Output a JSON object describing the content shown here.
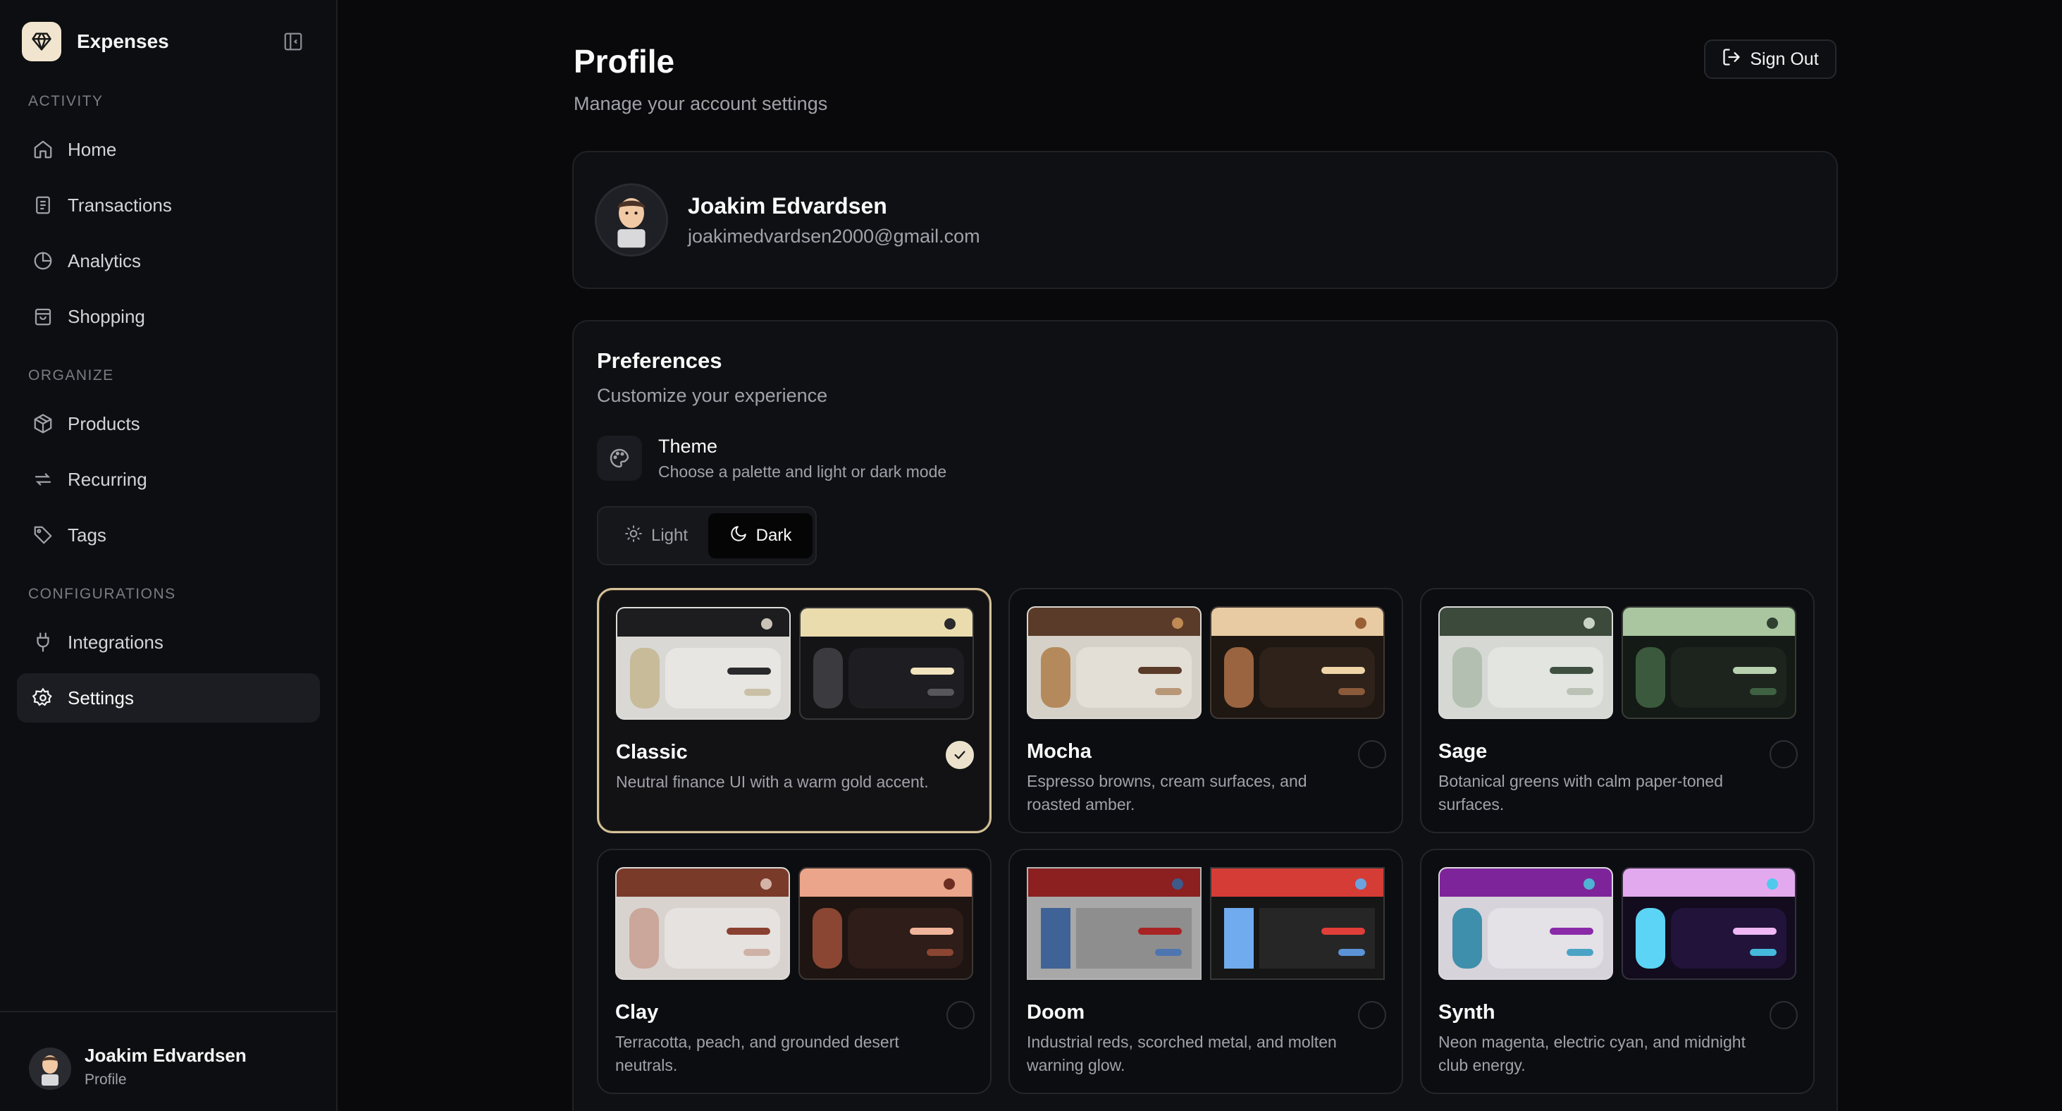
{
  "sidebar": {
    "brand": "Expenses",
    "sections": {
      "activity": "ACTIVITY",
      "organize": "ORGANIZE",
      "configurations": "CONFIGURATIONS"
    },
    "items": [
      {
        "label": "Home",
        "icon": "home-icon"
      },
      {
        "label": "Transactions",
        "icon": "receipt-icon"
      },
      {
        "label": "Analytics",
        "icon": "pie-chart-icon"
      },
      {
        "label": "Shopping",
        "icon": "shopping-bag-icon"
      },
      {
        "label": "Products",
        "icon": "package-icon"
      },
      {
        "label": "Recurring",
        "icon": "repeat-icon"
      },
      {
        "label": "Tags",
        "icon": "tag-icon"
      },
      {
        "label": "Integrations",
        "icon": "plug-icon"
      },
      {
        "label": "Settings",
        "icon": "gear-icon",
        "active": true
      }
    ],
    "footer": {
      "name": "Joakim Edvardsen",
      "sub": "Profile"
    }
  },
  "header": {
    "title": "Profile",
    "subtitle": "Manage your account settings",
    "sign_out": "Sign Out"
  },
  "profile": {
    "name": "Joakim Edvardsen",
    "email": "joakimedvardsen2000@gmail.com"
  },
  "preferences": {
    "title": "Preferences",
    "subtitle": "Customize your experience",
    "theme_title": "Theme",
    "theme_desc": "Choose a palette and light or dark mode",
    "mode_light": "Light",
    "mode_dark": "Dark",
    "selected_mode": "Dark"
  },
  "themes": [
    {
      "name": "Classic",
      "desc": "Neutral finance UI with a warm gold accent.",
      "selected": true
    },
    {
      "name": "Mocha",
      "desc": "Espresso browns, cream surfaces, and roasted amber.",
      "selected": false
    },
    {
      "name": "Sage",
      "desc": "Botanical greens with calm paper-toned surfaces.",
      "selected": false
    },
    {
      "name": "Clay",
      "desc": "Terracotta, peach, and grounded desert neutrals.",
      "selected": false
    },
    {
      "name": "Doom",
      "desc": "Industrial reds, scorched metal, and molten warning glow.",
      "selected": false
    },
    {
      "name": "Synth",
      "desc": "Neon magenta, electric cyan, and midnight club energy.",
      "selected": false
    }
  ],
  "colors": {
    "accent": "#d6c29a",
    "background": "#09090b",
    "card": "#0f1013"
  }
}
